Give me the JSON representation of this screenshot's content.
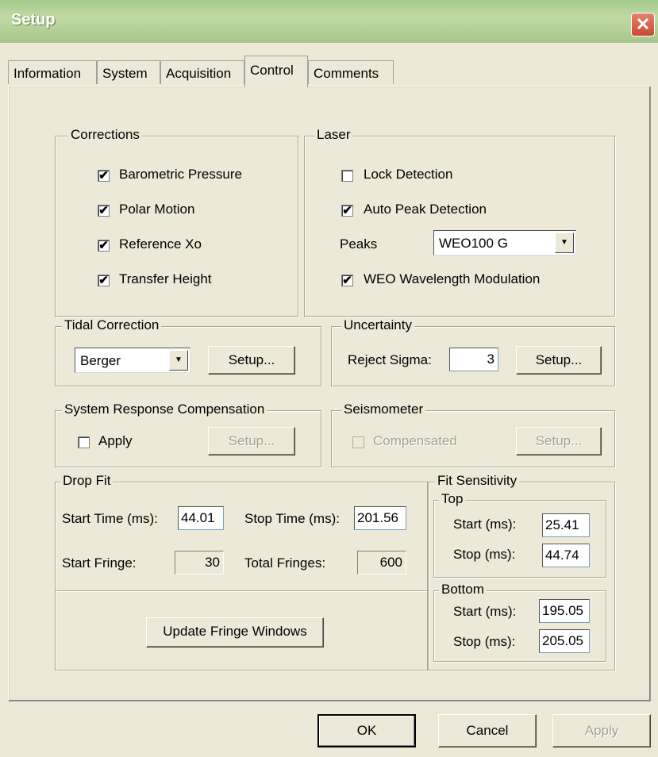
{
  "window": {
    "title": "Setup",
    "close_glyph": "✕"
  },
  "tabs": [
    "Information",
    "System",
    "Acquisition",
    "Control",
    "Comments"
  ],
  "active_tab": "Control",
  "corrections": {
    "title": "Corrections",
    "items": [
      {
        "label": "Barometric Pressure",
        "checked": true
      },
      {
        "label": "Polar Motion",
        "checked": true
      },
      {
        "label": "Reference Xo",
        "checked": true
      },
      {
        "label": "Transfer Height",
        "checked": true
      }
    ]
  },
  "laser": {
    "title": "Laser",
    "lock_detection": {
      "label": "Lock Detection",
      "checked": false
    },
    "auto_peak": {
      "label": "Auto Peak Detection",
      "checked": true
    },
    "peaks_label": "Peaks",
    "peaks_value": "WEO100 G",
    "weo_mod": {
      "label": "WEO Wavelength Modulation",
      "checked": true
    }
  },
  "tidal": {
    "title": "Tidal Correction",
    "value": "Berger",
    "setup": "Setup..."
  },
  "uncertainty": {
    "title": "Uncertainty",
    "reject_label": "Reject Sigma:",
    "reject_value": "3",
    "setup": "Setup..."
  },
  "srs": {
    "title": "System Response Compensation",
    "apply_label": "Apply",
    "apply_checked": false,
    "setup": "Setup..."
  },
  "seismometer": {
    "title": "Seismometer",
    "comp_label": "Compensated",
    "comp_checked": false,
    "setup": "Setup..."
  },
  "dropfit": {
    "title": "Drop Fit",
    "start_time_label": "Start Time (ms):",
    "start_time": "44.01",
    "stop_time_label": "Stop Time (ms):",
    "stop_time": "201.56",
    "start_fringe_label": "Start Fringe:",
    "start_fringe": "30",
    "total_fringes_label": "Total Fringes:",
    "total_fringes": "600",
    "update_button": "Update Fringe Windows"
  },
  "fit_sensitivity": {
    "title": "Fit Sensitivity",
    "top": {
      "title": "Top",
      "start_label": "Start (ms):",
      "start": "25.41",
      "stop_label": "Stop (ms):",
      "stop": "44.74"
    },
    "bottom": {
      "title": "Bottom",
      "start_label": "Start (ms):",
      "start": "195.05",
      "stop_label": "Stop (ms):",
      "stop": "205.05"
    }
  },
  "footer": {
    "ok": "OK",
    "cancel": "Cancel",
    "apply": "Apply"
  },
  "check_glyph": "✔",
  "dropdown_glyph": "▼"
}
